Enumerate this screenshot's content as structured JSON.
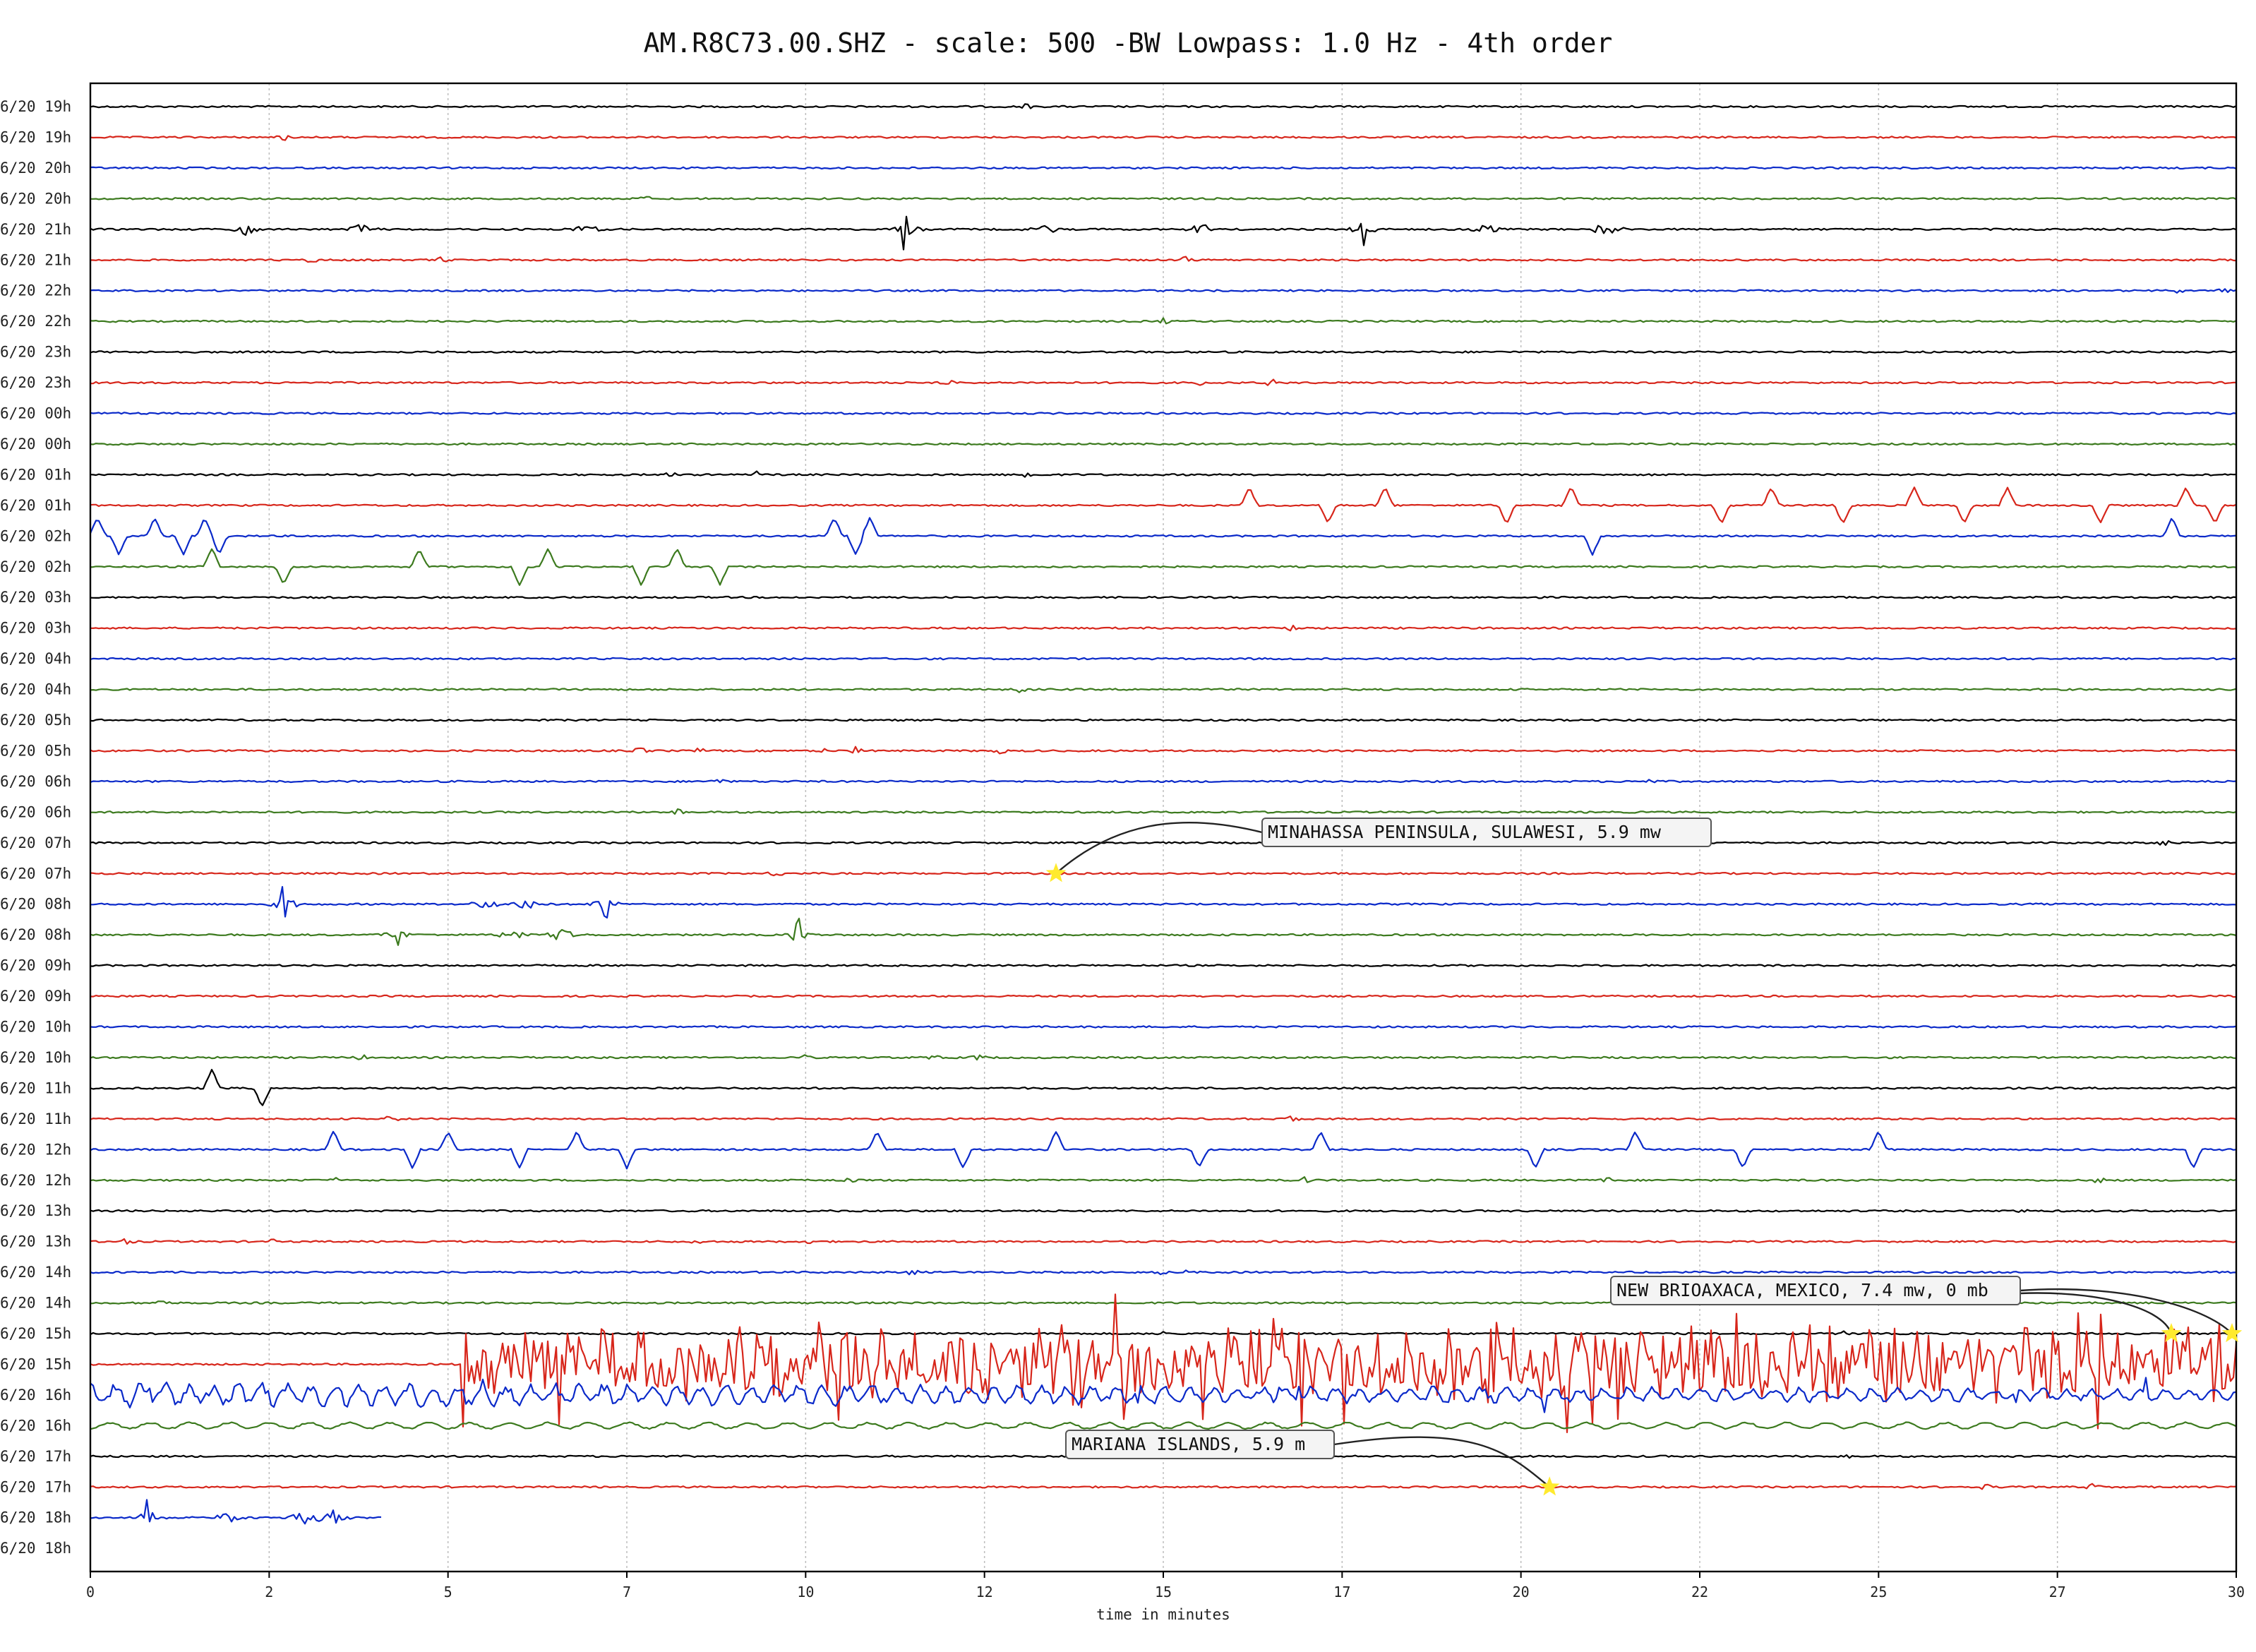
{
  "chart_data": {
    "type": "line",
    "title": "AM.R8C73.00.SHZ - scale: 500 -BW Lowpass: 1.0 Hz - 4th order",
    "xlabel": "time in minutes",
    "ylabel": "",
    "xlim": [
      0,
      30
    ],
    "x_ticks": [
      "0",
      "2",
      "5",
      "7",
      "10",
      "12",
      "15",
      "17",
      "20",
      "22",
      "25",
      "27",
      "30"
    ],
    "x_tick_values": [
      0,
      2.5,
      5,
      7.5,
      10,
      12.5,
      15,
      17.5,
      20,
      22.5,
      25,
      27.5,
      30
    ],
    "grid": true,
    "trace_colors": [
      "#000000",
      "#d7261b",
      "#0a29c9",
      "#3c7a1e"
    ],
    "rows": [
      {
        "label": "6/20 19h",
        "activity": "quiet",
        "bursts": [
          13.1
        ]
      },
      {
        "label": "6/20 19h",
        "activity": "quiet",
        "bursts": [
          2.7
        ]
      },
      {
        "label": "6/20 20h",
        "activity": "quiet",
        "bursts": []
      },
      {
        "label": "6/20 20h",
        "activity": "quiet",
        "bursts": [
          7.8
        ]
      },
      {
        "label": "6/20 21h",
        "activity": "bursts",
        "bursts": [
          2.2,
          3.8,
          6.9,
          11.4,
          13.3,
          15.5,
          17.8,
          19.5,
          21.2
        ]
      },
      {
        "label": "6/20 21h",
        "activity": "quiet",
        "bursts": [
          3.1,
          4.9,
          15.3
        ]
      },
      {
        "label": "6/20 22h",
        "activity": "quiet",
        "bursts": [
          29.2,
          29.8
        ]
      },
      {
        "label": "6/20 22h",
        "activity": "quiet",
        "bursts": [
          15.0
        ]
      },
      {
        "label": "6/20 23h",
        "activity": "quiet",
        "bursts": []
      },
      {
        "label": "6/20 23h",
        "activity": "quiet",
        "bursts": [
          12.0,
          15.5,
          16.5
        ]
      },
      {
        "label": "6/20 00h",
        "activity": "quiet",
        "bursts": []
      },
      {
        "label": "6/20 00h",
        "activity": "quiet",
        "bursts": []
      },
      {
        "label": "6/20 01h",
        "activity": "quiet",
        "bursts": [
          8.1,
          9.3,
          13.1
        ]
      },
      {
        "label": "6/20 01h",
        "activity": "spikes",
        "bursts": [
          16.2,
          17.3,
          18.1,
          19.8,
          20.7,
          22.8,
          23.5,
          24.5,
          25.5,
          26.2,
          26.8,
          28.1,
          29.3,
          29.7
        ]
      },
      {
        "label": "6/20 02h",
        "activity": "spikes",
        "bursts": [
          0.1,
          0.4,
          0.9,
          1.3,
          1.6,
          1.8,
          10.4,
          10.7,
          10.9,
          21.0,
          29.1
        ]
      },
      {
        "label": "6/20 02h",
        "activity": "spikes",
        "bursts": [
          1.7,
          2.7,
          4.6,
          6.0,
          6.4,
          7.7,
          8.2,
          8.8
        ]
      },
      {
        "label": "6/20 03h",
        "activity": "quiet",
        "bursts": []
      },
      {
        "label": "6/20 03h",
        "activity": "quiet",
        "bursts": [
          16.8
        ]
      },
      {
        "label": "6/20 04h",
        "activity": "quiet",
        "bursts": []
      },
      {
        "label": "6/20 04h",
        "activity": "quiet",
        "bursts": [
          13.0
        ]
      },
      {
        "label": "6/20 05h",
        "activity": "quiet",
        "bursts": []
      },
      {
        "label": "6/20 05h",
        "activity": "quiet",
        "bursts": [
          7.7,
          8.5,
          10.2,
          10.7,
          12.7
        ]
      },
      {
        "label": "6/20 06h",
        "activity": "quiet",
        "bursts": [
          8.8,
          21.8
        ]
      },
      {
        "label": "6/20 06h",
        "activity": "quiet",
        "bursts": [
          8.2
        ]
      },
      {
        "label": "6/20 07h",
        "activity": "quiet",
        "bursts": [
          29.0
        ]
      },
      {
        "label": "6/20 07h",
        "activity": "quiet",
        "bursts": [
          9.6
        ]
      },
      {
        "label": "6/20 08h",
        "activity": "bursts",
        "bursts": [
          2.7,
          5.5,
          6.1,
          7.2
        ]
      },
      {
        "label": "6/20 08h",
        "activity": "bursts",
        "bursts": [
          4.3,
          5.9,
          6.6,
          9.9
        ]
      },
      {
        "label": "6/20 09h",
        "activity": "quiet",
        "bursts": []
      },
      {
        "label": "6/20 09h",
        "activity": "quiet",
        "bursts": []
      },
      {
        "label": "6/20 10h",
        "activity": "quiet",
        "bursts": []
      },
      {
        "label": "6/20 10h",
        "activity": "quiet",
        "bursts": [
          3.8,
          10.0,
          11.8,
          12.4
        ]
      },
      {
        "label": "6/20 11h",
        "activity": "spikes",
        "bursts": [
          1.7,
          2.4
        ]
      },
      {
        "label": "6/20 11h",
        "activity": "quiet",
        "bursts": [
          4.2,
          16.8
        ]
      },
      {
        "label": "6/20 12h",
        "activity": "spikes",
        "bursts": [
          3.4,
          4.5,
          5.0,
          6.0,
          6.8,
          7.5,
          11.0,
          12.2,
          13.5,
          15.5,
          17.2,
          20.2,
          21.6,
          23.1,
          25.0,
          29.4
        ]
      },
      {
        "label": "6/20 12h",
        "activity": "quiet",
        "bursts": [
          3.4,
          10.6,
          17.0,
          21.2,
          28.1
        ]
      },
      {
        "label": "6/20 13h",
        "activity": "quiet",
        "bursts": [
          27.0
        ]
      },
      {
        "label": "6/20 13h",
        "activity": "quiet",
        "bursts": [
          0.5,
          2.5,
          8.5,
          10.0
        ]
      },
      {
        "label": "6/20 14h",
        "activity": "quiet",
        "bursts": [
          11.5,
          15.0,
          15.3
        ]
      },
      {
        "label": "6/20 14h",
        "activity": "quiet",
        "bursts": [
          1.0
        ]
      },
      {
        "label": "6/20 15h",
        "activity": "quiet",
        "bursts": [
          15.0,
          24.5
        ]
      },
      {
        "label": "6/20 15h",
        "activity": "earthquake",
        "onset": 5.2,
        "end": 30
      },
      {
        "label": "6/20 16h",
        "activity": "earthquake",
        "onset": 0,
        "end": 30
      },
      {
        "label": "6/20 16h",
        "activity": "microseism",
        "bursts": []
      },
      {
        "label": "6/20 17h",
        "activity": "quiet",
        "bursts": [
          24.6
        ]
      },
      {
        "label": "6/20 17h",
        "activity": "quiet",
        "bursts": [
          26.5,
          28.0
        ]
      },
      {
        "label": "6/20 18h",
        "activity": "partial",
        "bursts": [
          0.8,
          1.9,
          3.0,
          3.4
        ],
        "end": 4.1
      },
      {
        "label": "6/20 18h",
        "activity": "empty",
        "bursts": []
      }
    ],
    "annotations": [
      {
        "text": "MINAHASSA PENINSULA, SULAWESI, 5.9 mw",
        "row": 25,
        "minute": 13.5
      },
      {
        "text": "NEW BRIOAXACA, MEXICO, 7.4 mw, 0 mb",
        "row": 40,
        "minute": 30
      },
      {
        "text": "MARIANA ISLANDS, 5.9 m",
        "row": 45,
        "minute": 20.4
      }
    ]
  }
}
